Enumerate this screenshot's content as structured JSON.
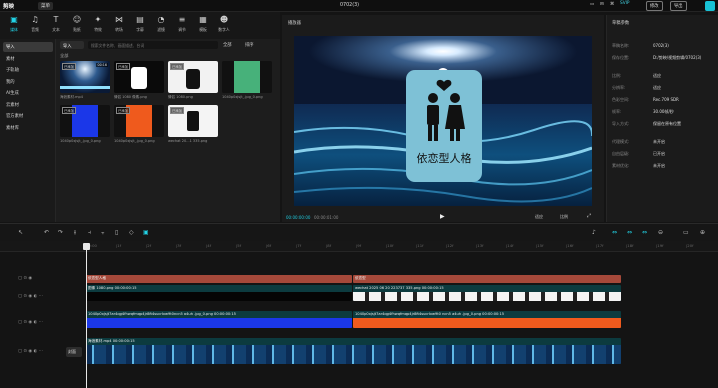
{
  "app": {
    "logo": "剪映",
    "menu": "菜单",
    "project_title": "0702(3)"
  },
  "titlebar": {
    "vip": "SVIP",
    "modify": "修改",
    "export": "导出"
  },
  "toolbar": [
    {
      "icon": "media-icon",
      "glyph": "▣",
      "label": "媒体",
      "active": true
    },
    {
      "icon": "audio-icon",
      "glyph": "♫",
      "label": "音频"
    },
    {
      "icon": "text-icon",
      "glyph": "T",
      "label": "文本"
    },
    {
      "icon": "sticker-icon",
      "glyph": "☺",
      "label": "贴纸"
    },
    {
      "icon": "effects-icon",
      "glyph": "✦",
      "label": "特效"
    },
    {
      "icon": "transition-icon",
      "glyph": "⋈",
      "label": "转场"
    },
    {
      "icon": "caption-icon",
      "glyph": "▤",
      "label": "字幕"
    },
    {
      "icon": "filter-icon",
      "glyph": "◔",
      "label": "滤镜"
    },
    {
      "icon": "adjust-icon",
      "glyph": "≡",
      "label": "调节"
    },
    {
      "icon": "template-icon",
      "glyph": "▦",
      "label": "模板"
    },
    {
      "icon": "digital-human-icon",
      "glyph": "☻",
      "label": "数字人"
    }
  ],
  "sidebar": [
    {
      "label": "导入",
      "active": true
    },
    {
      "label": "素材"
    },
    {
      "label": "子轨轴"
    },
    {
      "label": "我的"
    },
    {
      "label": "AI生成"
    },
    {
      "label": "云素材"
    },
    {
      "label": "官方素材"
    },
    {
      "label": "素材库"
    }
  ],
  "media": {
    "import": "导入",
    "search_placeholder": "搜索文件名称、画面描述、台词",
    "all": "全部",
    "sort": "排序",
    "label": "全部",
    "items": [
      {
        "caption": "海浪素材.mp4",
        "tag": "已添加",
        "duration": "00:16",
        "kind": "ocean"
      },
      {
        "caption": "情侣 1080 像素.png",
        "tag": "已添加",
        "kind": "couple-black"
      },
      {
        "caption": "情侣 1080.png",
        "tag": "已添加",
        "kind": "couple-white"
      },
      {
        "caption": "1040p0xjsjt_.jpg_0.png",
        "tag": "",
        "kind": "green"
      },
      {
        "caption": "1040p0xjsjt_.jpg_0.png",
        "tag": "已添加",
        "kind": "blue"
      },
      {
        "caption": "1040p0xjsjt_.jpg_0.png",
        "tag": "已添加",
        "kind": "orange"
      },
      {
        "caption": "wechat 20...1 335.png",
        "tag": "已添加",
        "kind": "robot"
      }
    ]
  },
  "player": {
    "title": "播放器",
    "overlay_text": "依恋型人格",
    "time_current": "00:00:00:00",
    "time_total": "00:00:01:00",
    "zoom": "适应",
    "ratio": "比例"
  },
  "rpanel": {
    "title": "草稿参数",
    "rows": [
      {
        "k": "草稿名称:",
        "v": "0702(3)"
      },
      {
        "k": "保存位置:",
        "v": "D:/剪映/视频剪辑/0702(3)"
      },
      {
        "k": "比例:",
        "v": "适应"
      },
      {
        "k": "分辨率:",
        "v": "适应"
      },
      {
        "k": "色彩空间:",
        "v": "Rec.709 SDR"
      },
      {
        "k": "帧率:",
        "v": "30.00帧/秒"
      },
      {
        "k": "导入方式:",
        "v": "保留在原有位置"
      },
      {
        "k": "代理模式:",
        "v": "未开启"
      },
      {
        "k": "自由层级:",
        "v": "已开启"
      },
      {
        "k": "素材优化:",
        "v": "未开启"
      }
    ]
  },
  "ruler": {
    "ticks": [
      "00:00",
      "|1f",
      "|2f",
      "|3f",
      "|4f",
      "|5f",
      "|6f",
      "|7f",
      "|8f",
      "|9f",
      "|10f",
      "|11f",
      "|12f",
      "|13f",
      "|14f",
      "|15f",
      "|16f",
      "|17f",
      "|18f",
      "|19f",
      "|20f"
    ]
  },
  "tracks": {
    "text_a": "依恋型人格",
    "text_b": "依恋型",
    "img_a": "图像 1080.png  00:00:00:15",
    "img_b": "wechat 2025 06 20 223737 335.png  00:00:00:15",
    "blue": "1040p0xjsjt7ar4qg4fhwqfmqp4jr8ft4sucrIxw9t0ncn5 a4uh .jpg_0.png  00:00:00:15",
    "orange": "1040p0xjsjt7ar4qg4fhwqfmqp4jr8ft4sucrIxw9t0 ncn5 a4uh .jpg_0.png  00:00:00:15",
    "main": "海浪素材.mp4  00:00:00:15",
    "cover": "封面"
  }
}
